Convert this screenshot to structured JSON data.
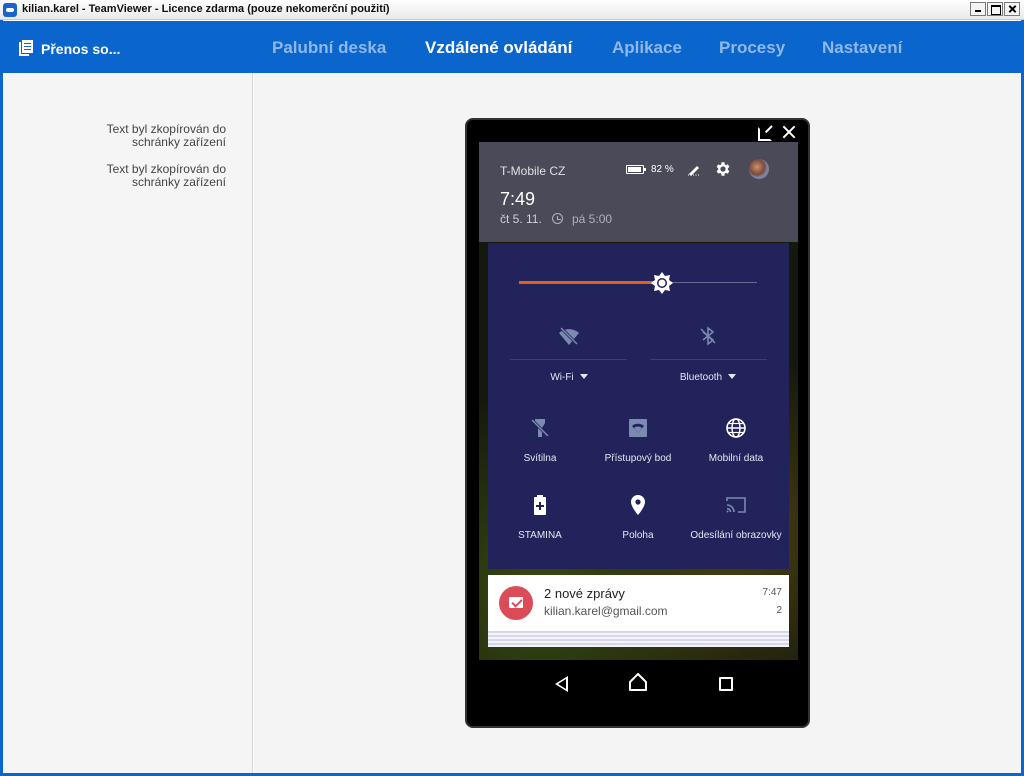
{
  "window": {
    "title": "kilian.karel - TeamViewer - Licence zdarma (pouze nekomerční použití)"
  },
  "header": {
    "brand": "Přenos so...",
    "tabs": [
      {
        "label": "Palubní deska",
        "active": false
      },
      {
        "label": "Vzdálené ovládání",
        "active": true
      },
      {
        "label": "Aplikace",
        "active": false
      },
      {
        "label": "Procesy",
        "active": false
      },
      {
        "label": "Nastavení",
        "active": false
      }
    ]
  },
  "log": [
    {
      "line1": "Text byl zkopírován do",
      "line2": "schránky zařízení"
    },
    {
      "line1": "Text byl zkopírován do",
      "line2": "schránky zařízení"
    }
  ],
  "phone": {
    "status": {
      "carrier": "T-Mobile CZ",
      "battery_pct": "82 %",
      "time": "7:49",
      "date": "čt 5. 11.",
      "alarm": "pá 5:00"
    },
    "brightness": 0.6,
    "quick_settings": {
      "wifi_label": "Wi-Fi",
      "bluetooth_label": "Bluetooth",
      "tiles": [
        {
          "label": "Svítilna",
          "icon": "flashlight-icon"
        },
        {
          "label": "Přístupový bod",
          "icon": "hotspot-icon"
        },
        {
          "label": "Mobilní data",
          "icon": "globe-icon"
        },
        {
          "label": "STAMINA",
          "icon": "battery-plus-icon"
        },
        {
          "label": "Poloha",
          "icon": "location-pin-icon"
        },
        {
          "label": "Odesílání obrazovky",
          "icon": "cast-icon"
        }
      ]
    },
    "notification": {
      "title": "2 nové zprávy",
      "subtitle": "kilian.karel@gmail.com",
      "time": "7:47",
      "count": "2"
    }
  },
  "colors": {
    "header_blue": "#0a65cc",
    "tab_inactive": "#8fb8ea",
    "qs_background": "#22235a",
    "slider_accent": "#e0601c",
    "gmail_red": "#db4b58"
  }
}
